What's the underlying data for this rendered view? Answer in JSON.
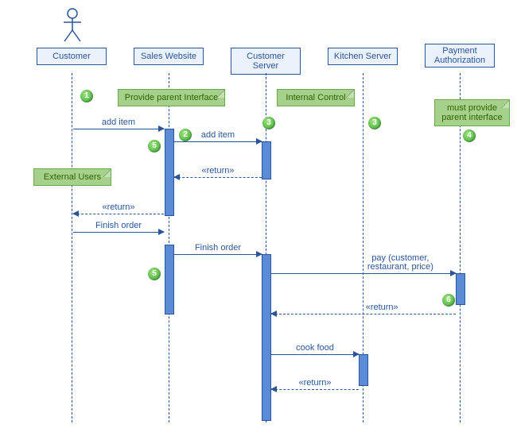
{
  "lifelines": {
    "customer": "Customer",
    "sales": "Sales Website",
    "custserver": "Customer Server",
    "kitchen": "Kitchen Server",
    "payment": "Payment\nAuthorization"
  },
  "notes": {
    "parent_iface": "Provide parent Interface",
    "internal": "Internal Control",
    "must_provide": "must provide parent interface",
    "external": "External Users"
  },
  "messages": {
    "add_item1": "add item",
    "add_item2": "add item",
    "return1": "«return»",
    "return2": "«return»",
    "finish1": "Finish order",
    "finish2": "Finish order",
    "pay": "pay (customer, restaurant, price)",
    "return3": "«return»",
    "cook": "cook food",
    "return4": "«return»"
  },
  "badges": {
    "b1": "1",
    "b2": "2",
    "b3a": "3",
    "b3b": "3",
    "b4": "4",
    "b5a": "5",
    "b5b": "5",
    "b6": "6"
  }
}
